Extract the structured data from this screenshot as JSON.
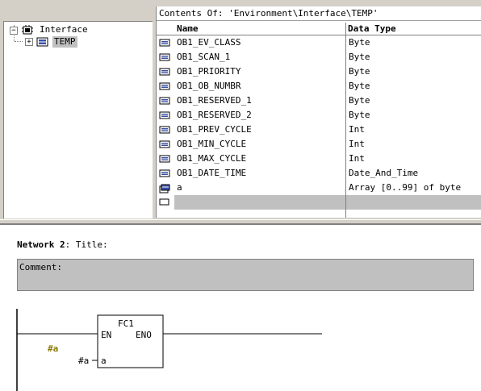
{
  "tree": {
    "root_label": "Interface",
    "root_expander": "−",
    "child_label": "TEMP",
    "child_expander": "+"
  },
  "contents": {
    "title": "Contents Of: 'Environment\\Interface\\TEMP'",
    "columns": {
      "name": "Name",
      "type": "Data Type"
    },
    "rows": [
      {
        "name": "OB1_EV_CLASS",
        "type": "Byte"
      },
      {
        "name": "OB1_SCAN_1",
        "type": "Byte"
      },
      {
        "name": "OB1_PRIORITY",
        "type": "Byte"
      },
      {
        "name": "OB1_OB_NUMBR",
        "type": "Byte"
      },
      {
        "name": "OB1_RESERVED_1",
        "type": "Byte"
      },
      {
        "name": "OB1_RESERVED_2",
        "type": "Byte"
      },
      {
        "name": "OB1_PREV_CYCLE",
        "type": "Int"
      },
      {
        "name": "OB1_MIN_CYCLE",
        "type": "Int"
      },
      {
        "name": "OB1_MAX_CYCLE",
        "type": "Int"
      },
      {
        "name": "OB1_DATE_TIME",
        "type": "Date_And_Time"
      },
      {
        "name": "a",
        "type": "Array [0..99] of byte"
      },
      {
        "name": "",
        "type": ""
      }
    ]
  },
  "network": {
    "label": "Network 2",
    "separator": ":",
    "title": "Title:",
    "comment": "Comment:",
    "block": {
      "name": "FC1",
      "en": "EN",
      "eno": "ENO",
      "param": "a",
      "actual": "#a",
      "annotation": "#a"
    }
  },
  "colors": {
    "window_bg": "#d4d0c8",
    "selected_row": "#c0c0c0",
    "annotation": "#8b7a00"
  }
}
